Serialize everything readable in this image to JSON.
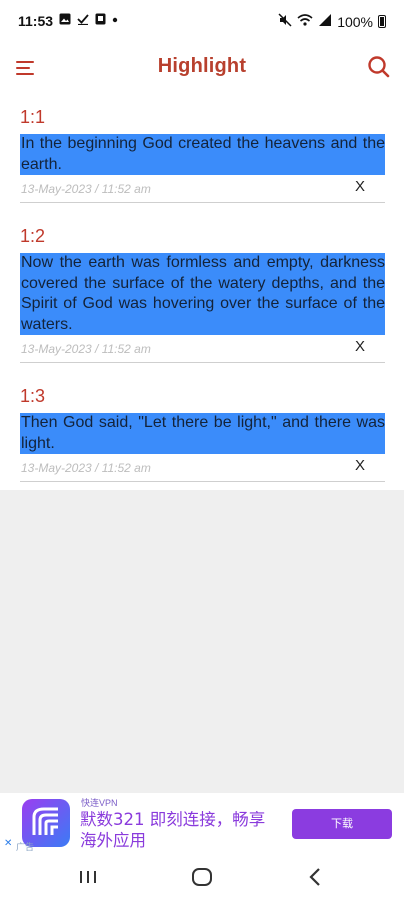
{
  "status_bar": {
    "time": "11:53",
    "battery": "100%",
    "left_icons": [
      "image-icon",
      "check-icon",
      "notification-icon",
      "dot-icon"
    ],
    "right_icons": [
      "mute-icon",
      "wifi-icon",
      "signal-icon",
      "battery-icon"
    ]
  },
  "app_bar": {
    "title": "Highlight",
    "accent_color": "#b8402e"
  },
  "highlights": [
    {
      "ref": "1:1",
      "text": "In the beginning God created the heavens and the earth.",
      "timestamp": "13-May-2023 / 11:52 am",
      "delete_label": "X"
    },
    {
      "ref": "1:2",
      "text": "Now the earth was formless and empty, darkness covered the surface of the watery depths, and the Spirit of God was hovering over the surface of the waters.",
      "timestamp": "13-May-2023 / 11:52 am",
      "delete_label": "X"
    },
    {
      "ref": "1:3",
      "text": "Then God said, \"Let there be light,\" and there was light.",
      "timestamp": "13-May-2023 / 11:52 am",
      "delete_label": "X"
    }
  ],
  "highlight_color": "#3b8cfa",
  "ad": {
    "brand": "快连VPN",
    "text": "默数321 即刻连接，畅享海外应用",
    "cta": "下载",
    "label": "广告",
    "close": "✕"
  },
  "nav_bar": {
    "buttons": [
      "recents-icon",
      "home-icon",
      "back-icon"
    ]
  }
}
